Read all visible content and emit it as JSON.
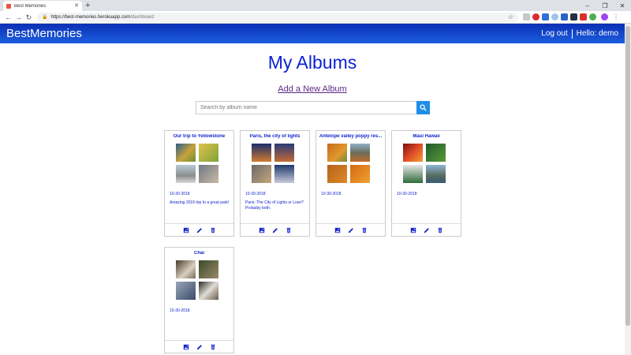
{
  "browser": {
    "tab_title": "Best Memories",
    "url_host": "https://best-memories.herokuapp.com",
    "url_path": "/dashboard"
  },
  "navbar": {
    "brand": "BestMemories",
    "logout": "Log out",
    "greeting": "Hello: demo"
  },
  "page": {
    "title": "My Albums",
    "add_album": "Add a New Album"
  },
  "search": {
    "placeholder": "Search by album name"
  },
  "albums": [
    {
      "title": "Our trip to Yellowstone",
      "date": "10-30-2018",
      "description": "Amazing 2019 trip to a great park!"
    },
    {
      "title": "Paris, the city of lights",
      "date": "10-30-2018",
      "description": "Paris: The City of Lights or Love? Probably both."
    },
    {
      "title": "Antelope valley poppy res...",
      "date": "10-30-2018",
      "description": ""
    },
    {
      "title": "Maui Hawaii",
      "date": "10-30-2018",
      "description": ""
    },
    {
      "title": "Chai",
      "date": "10-30-2018",
      "description": ""
    }
  ],
  "icons": {
    "view": "photo-album-icon",
    "edit": "pencil-icon",
    "delete": "trash-icon"
  },
  "colors": {
    "brand_blue": "#0a1fd6",
    "search_button": "#1f8ee8"
  }
}
